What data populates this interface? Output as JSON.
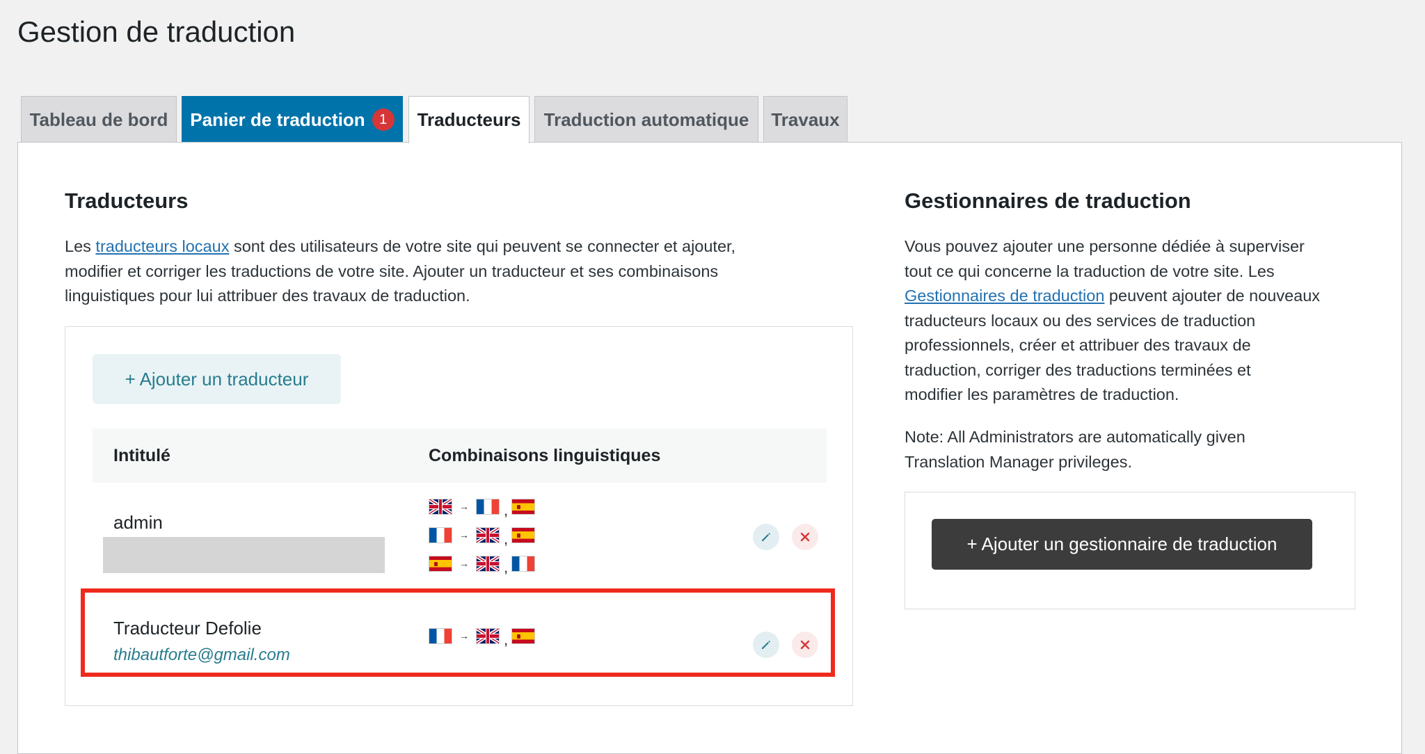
{
  "page": {
    "title": "Gestion de traduction"
  },
  "tabs": [
    {
      "label": "Tableau de bord"
    },
    {
      "label": "Panier de traduction",
      "badge": "1"
    },
    {
      "label": "Traducteurs"
    },
    {
      "label": "Traduction automatique"
    },
    {
      "label": "Travaux"
    }
  ],
  "translators": {
    "heading": "Traducteurs",
    "desc_pre": "Les ",
    "desc_link": "traducteurs locaux",
    "desc_line1_rest": " sont des utilisateurs de votre site qui peuvent se connecter et ajouter,",
    "desc_line2": "modifier et corriger les traductions de votre site. Ajouter un traducteur et ses combinaisons",
    "desc_line3": "linguistiques pour lui attribuer des travaux de traduction.",
    "add_button": "+ Ajouter un traducteur",
    "table": {
      "columns": [
        "Intitulé",
        "Combinaisons linguistiques"
      ],
      "rows": [
        {
          "name": "admin",
          "email": "",
          "pairs": [
            {
              "from": "gb-flag-icon",
              "to": [
                "fr-flag-icon",
                "es-flag-icon"
              ]
            },
            {
              "from": "fr-flag-icon",
              "to": [
                "gb-flag-icon",
                "es-flag-icon"
              ]
            },
            {
              "from": "es-flag-icon",
              "to": [
                "gb-flag-icon",
                "fr-flag-icon"
              ]
            }
          ]
        },
        {
          "name": "Traducteur Defolie",
          "email": "thibautforte@gmail.com",
          "pairs": [
            {
              "from": "fr-flag-icon",
              "to": [
                "gb-flag-icon",
                "es-flag-icon"
              ]
            }
          ]
        }
      ]
    }
  },
  "managers": {
    "heading": "Gestionnaires de traduction",
    "line1": "Vous pouvez ajouter une personne dédiée à superviser",
    "line2": "tout ce qui concerne la traduction de votre site. Les",
    "link": "Gestionnaires de traduction",
    "line3_rest": " peuvent ajouter de nouveaux",
    "line4": "traducteurs locaux ou des services de traduction",
    "line5": "professionnels, créer et attribuer des travaux de",
    "line6": "traduction, corriger des traductions terminées et",
    "line7": "modifier les paramètres de traduction.",
    "note1": "Note: All Administrators are automatically given",
    "note2": "Translation Manager privileges.",
    "add_button": "+ Ajouter un gestionnaire de traduction"
  },
  "colors": {
    "accent_blue": "#0073aa",
    "link": "#2271b1",
    "teal": "#287c8e",
    "badge": "#d63638",
    "highlight": "#ef2a1c"
  }
}
